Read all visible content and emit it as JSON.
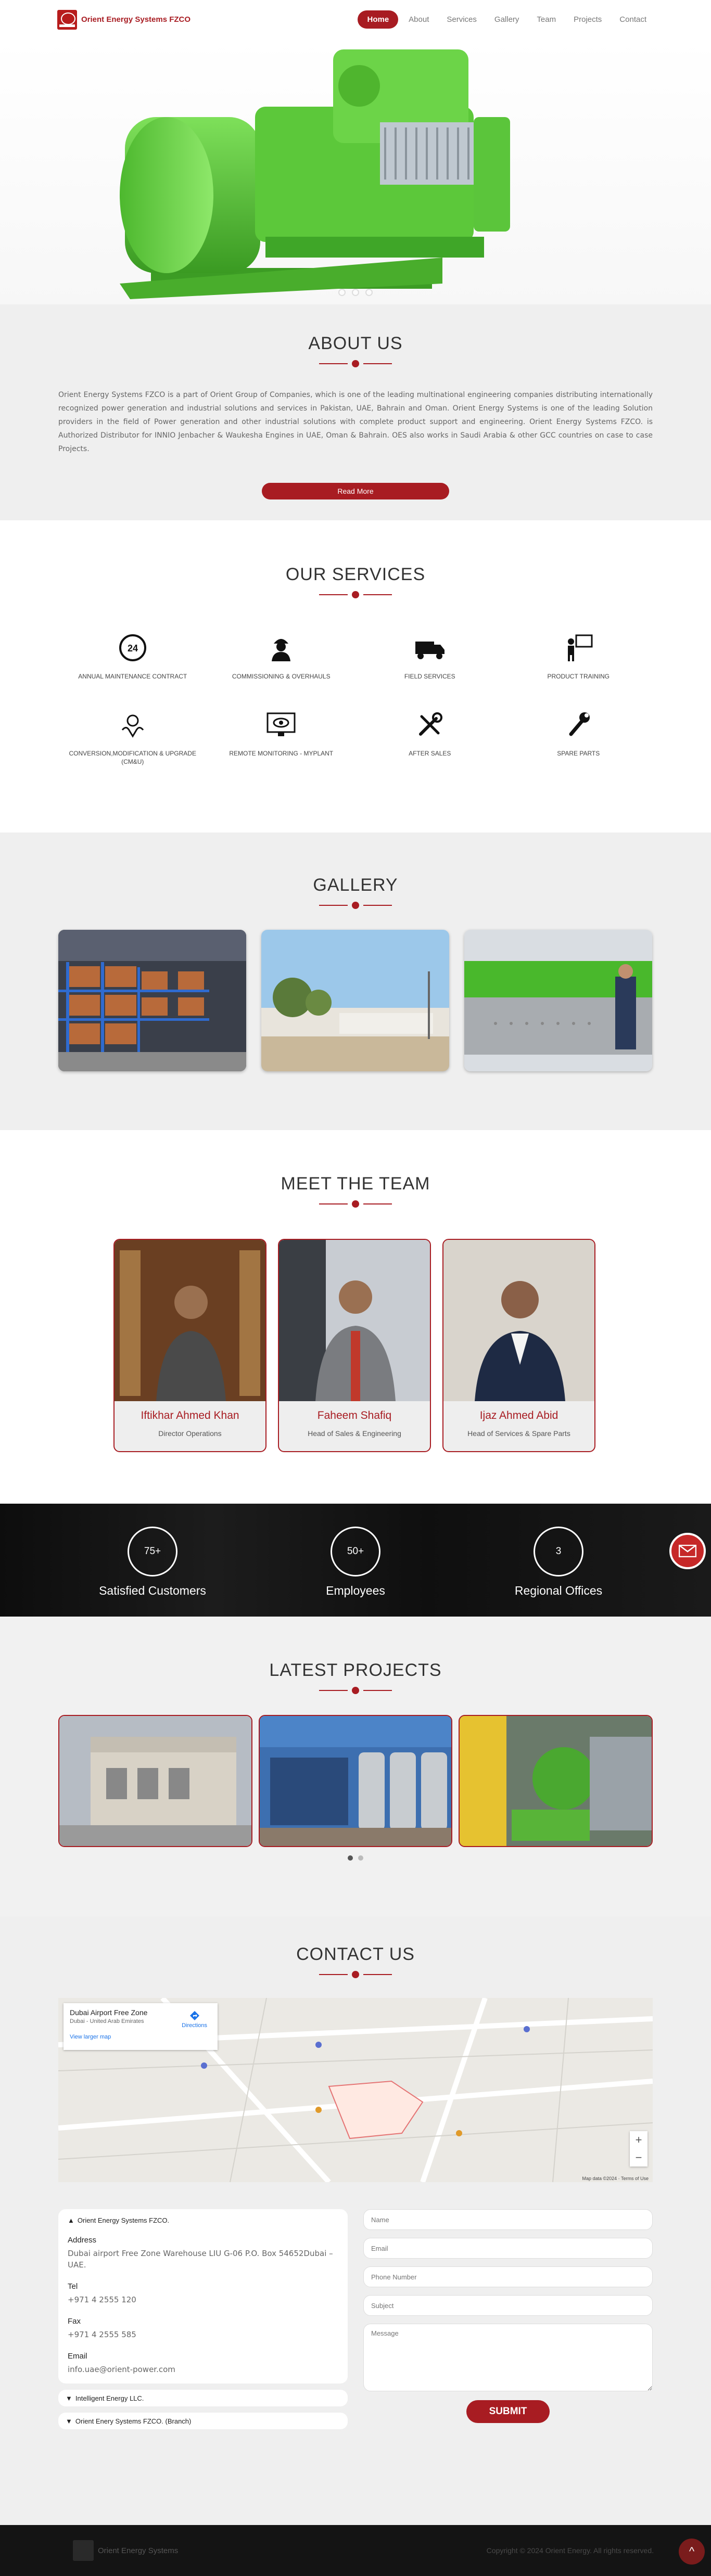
{
  "brand": {
    "name": "Orient Energy Systems FZCO",
    "logo_text": "ORIENT"
  },
  "nav": [
    {
      "label": "Home",
      "active": true
    },
    {
      "label": "About"
    },
    {
      "label": "Services"
    },
    {
      "label": "Gallery"
    },
    {
      "label": "Team"
    },
    {
      "label": "Projects"
    },
    {
      "label": "Contact"
    }
  ],
  "about": {
    "title": "ABOUT US",
    "text": "Orient Energy Systems FZCO is a part of Orient Group of Companies, which is one of the leading multinational engineering companies distributing internationally recognized power generation and industrial solutions and services in Pakistan, UAE, Bahrain and Oman. Orient Energy Systems is one of the leading Solution providers in the field of Power generation and other industrial solutions with complete product support and engineering. Orient Energy Systems FZCO. is Authorized Distributor for INNIO Jenbacher & Waukesha Engines in UAE, Oman & Bahrain. OES also works in Saudi Arabia & other GCC countries on case to case Projects.",
    "button": "Read More"
  },
  "services": {
    "title": "OUR SERVICES",
    "items": [
      {
        "label": "ANNUAL MAINTENANCE CONTRACT",
        "icon": "24h-clock-icon"
      },
      {
        "label": "COMMISSIONING & OVERHAULS",
        "icon": "worker-icon"
      },
      {
        "label": "FIELD SERVICES",
        "icon": "truck-icon"
      },
      {
        "label": "PRODUCT TRAINING",
        "icon": "training-icon"
      },
      {
        "label": "CONVERSION,MODIFICATION & UPGRADE (CM&U)",
        "icon": "upgrade-icon"
      },
      {
        "label": "REMOTE MONITORING - MYPLANT",
        "icon": "monitor-eye-icon"
      },
      {
        "label": "AFTER SALES",
        "icon": "tools-icon"
      },
      {
        "label": "SPARE PARTS",
        "icon": "spanner-icon"
      }
    ]
  },
  "gallery": {
    "title": "GALLERY"
  },
  "team": {
    "title": "MEET THE TEAM",
    "members": [
      {
        "name": "Iftikhar Ahmed Khan",
        "role": "Director Operations"
      },
      {
        "name": "Faheem Shafiq",
        "role": "Head of Sales & Engineering"
      },
      {
        "name": "Ijaz Ahmed Abid",
        "role": "Head of Services & Spare Parts"
      }
    ]
  },
  "stats": [
    {
      "value": "75+",
      "label": "Satisfied Customers"
    },
    {
      "value": "50+",
      "label": "Employees"
    },
    {
      "value": "3",
      "label": "Regional Offices"
    }
  ],
  "projects": {
    "title": "LATEST PROJECTS"
  },
  "contact": {
    "title": "CONTACT US",
    "map": {
      "place": "Dubai Airport Free Zone",
      "region": "Dubai - United Arab Emirates",
      "directions": "Directions",
      "larger": "View larger map",
      "footer": "Map data ©2024 · Terms of Use"
    },
    "office": {
      "heading": "Orient Energy Systems FZCO.",
      "address_label": "Address",
      "address": "Dubai airport Free Zone Warehouse LIU G-06 P.O. Box 54652Dubai – UAE.",
      "tel_label": "Tel",
      "tel": "+971 4 2555 120",
      "fax_label": "Fax",
      "fax": "+971 4 2555 585",
      "email_label": "Email",
      "email": "info.uae@orient-power.com"
    },
    "other_offices": [
      "Intelligent Energy LLC.",
      "Orient Enery Systems FZCO. (Branch)"
    ],
    "form": {
      "name": "Name",
      "email": "Email",
      "phone": "Phone Number",
      "subject": "Subject",
      "message": "Message",
      "submit": "SUBMIT"
    }
  },
  "footer": {
    "brand": "Orient Energy Systems",
    "copyright": "Copyright © 2024 Orient Energy. All rights reserved."
  },
  "colors": {
    "accent": "#a81c22",
    "engine_green": "#5ac83a"
  }
}
